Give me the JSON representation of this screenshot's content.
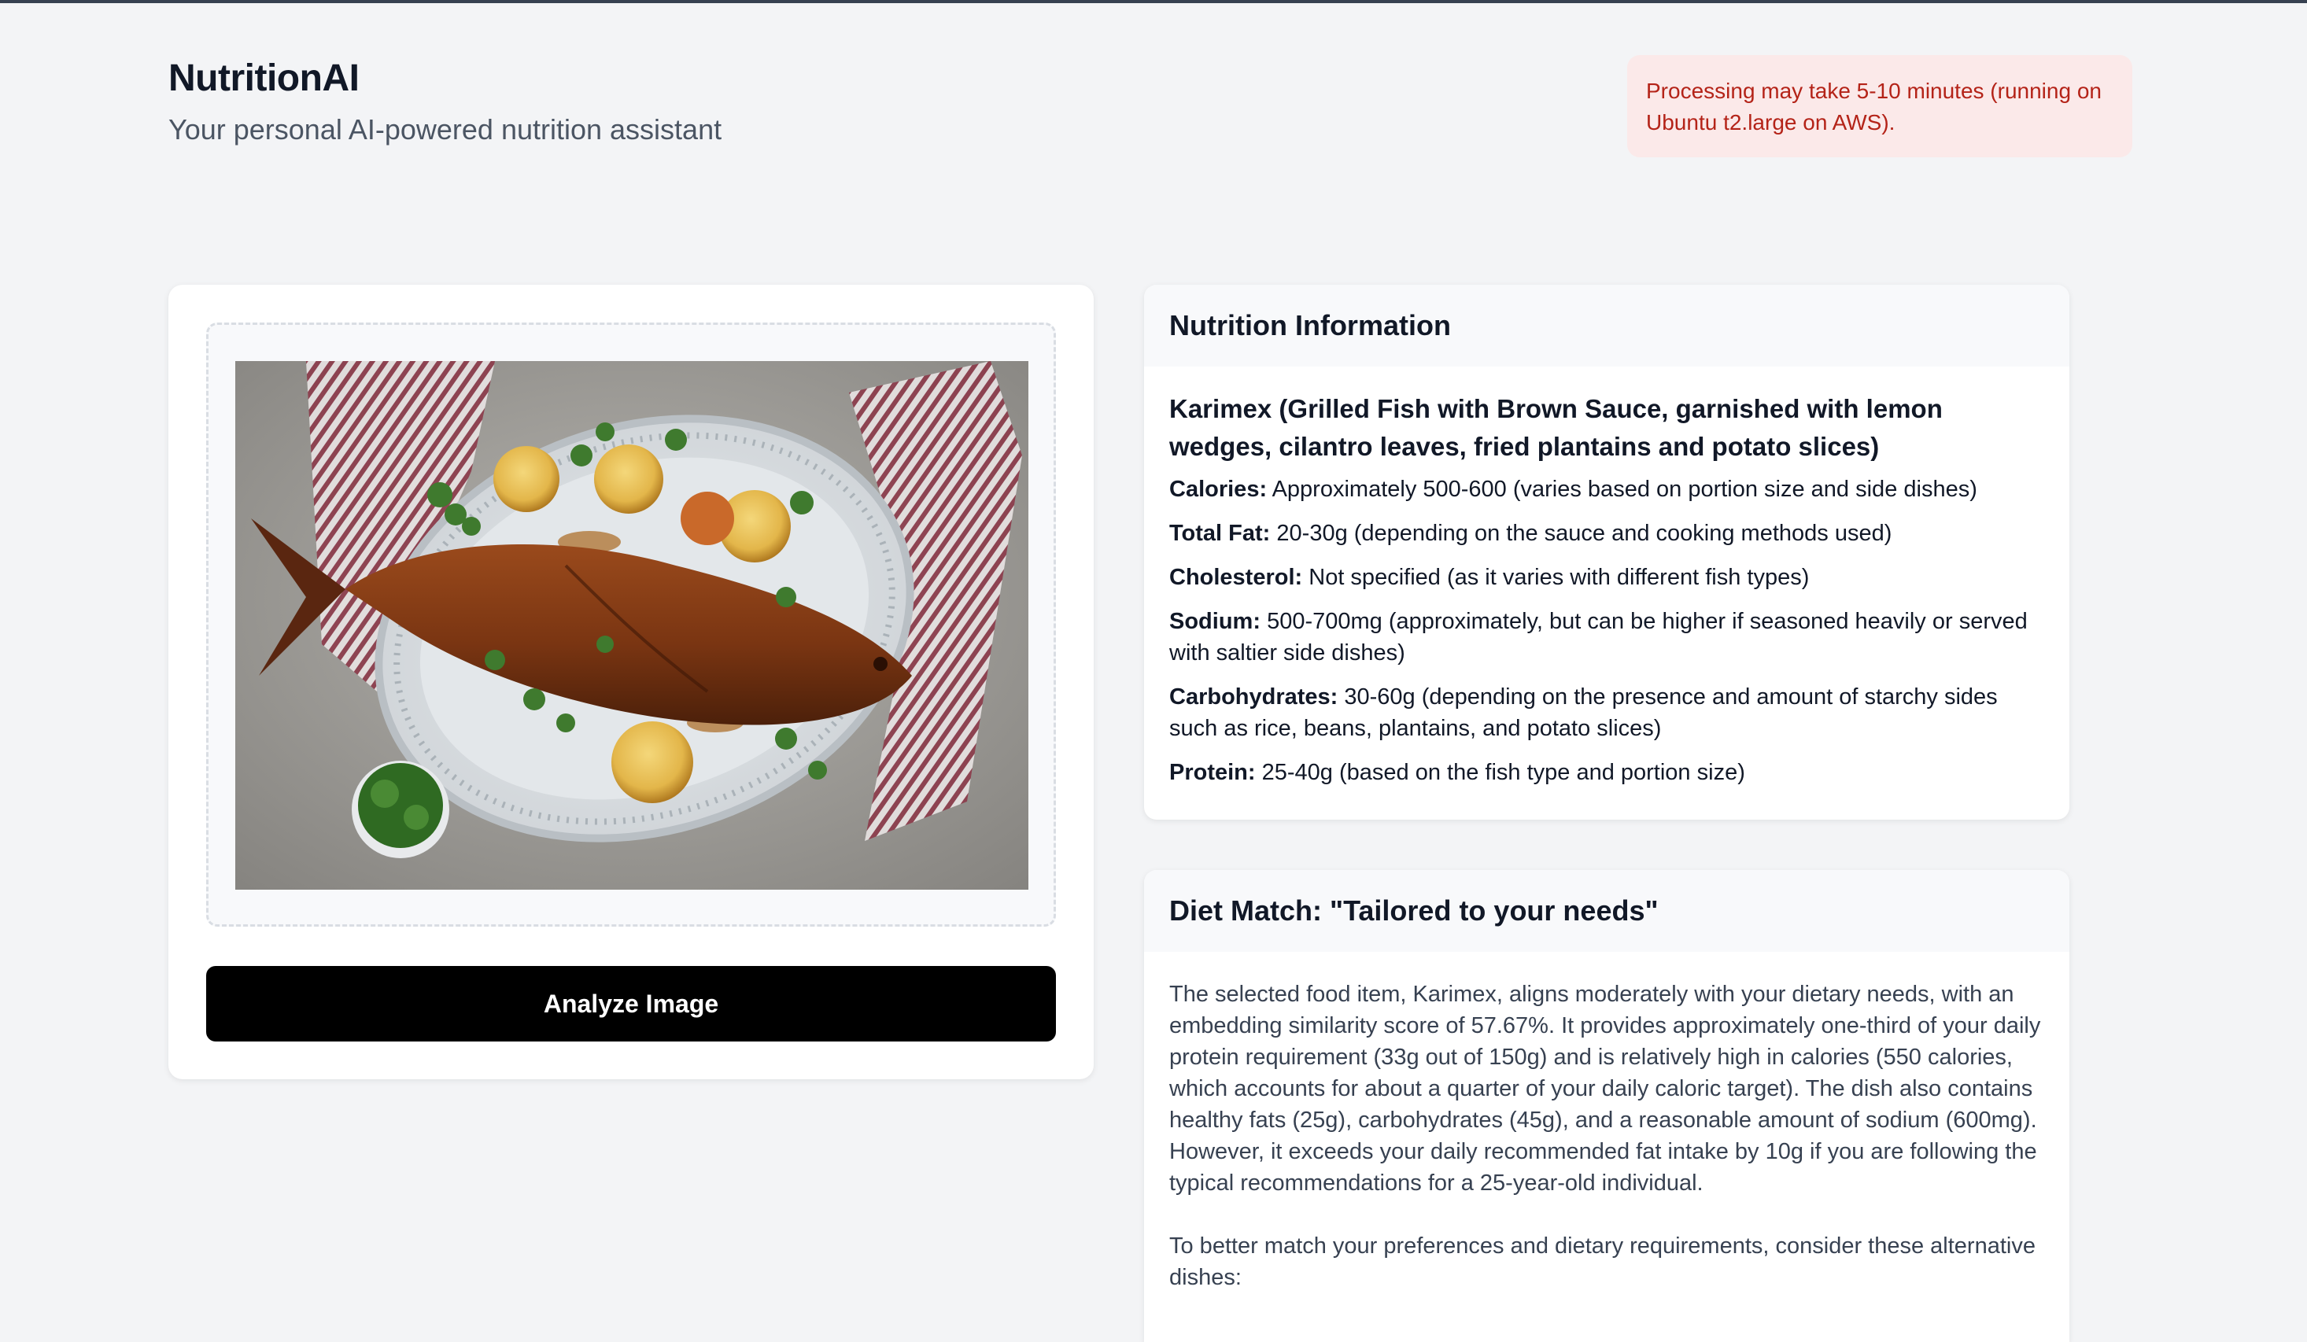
{
  "app": {
    "title": "NutritionAI",
    "subtitle": "Your personal AI-powered nutrition assistant"
  },
  "notice": {
    "text": "Processing may take 5-10 minutes (running on Ubuntu t2.large on AWS).",
    "color": "#b42318"
  },
  "upload": {
    "image_subject": "grilled-fish-plate",
    "analyze_label": "Analyze Image"
  },
  "nutrition": {
    "heading": "Nutrition Information",
    "food_name": "Karimex (Grilled Fish with Brown Sauce, garnished with lemon wedges, cilantro leaves, fried plantains and potato slices)",
    "facts": [
      {
        "label": "Calories:",
        "value": "Approximately 500-600 (varies based on portion size and side dishes)"
      },
      {
        "label": "Total Fat:",
        "value": "20-30g (depending on the sauce and cooking methods used)"
      },
      {
        "label": "Cholesterol:",
        "value": "Not specified (as it varies with different fish types)"
      },
      {
        "label": "Sodium:",
        "value": "500-700mg (approximately, but can be higher if seasoned heavily or served with saltier side dishes)"
      },
      {
        "label": "Carbohydrates:",
        "value": "30-60g (depending on the presence and amount of starchy sides such as rice, beans, plantains, and potato slices)"
      },
      {
        "label": "Protein:",
        "value": "25-40g (based on the fish type and portion size)"
      }
    ]
  },
  "diet": {
    "heading": "Diet Match: \"Tailored to your needs\"",
    "paragraphs": [
      "The selected food item, Karimex, aligns moderately with your dietary needs, with an embedding similarity score of 57.67%. It provides approximately one-third of your daily protein requirement (33g out of 150g) and is relatively high in calories (550 calories, which accounts for about a quarter of your daily caloric target). The dish also contains healthy fats (25g), carbohydrates (45g), and a reasonable amount of sodium (600mg). However, it exceeds your daily recommended fat intake by 10g if you are following the typical recommendations for a 25-year-old individual.",
      "To better match your preferences and dietary requirements, consider these alternative dishes:"
    ]
  }
}
